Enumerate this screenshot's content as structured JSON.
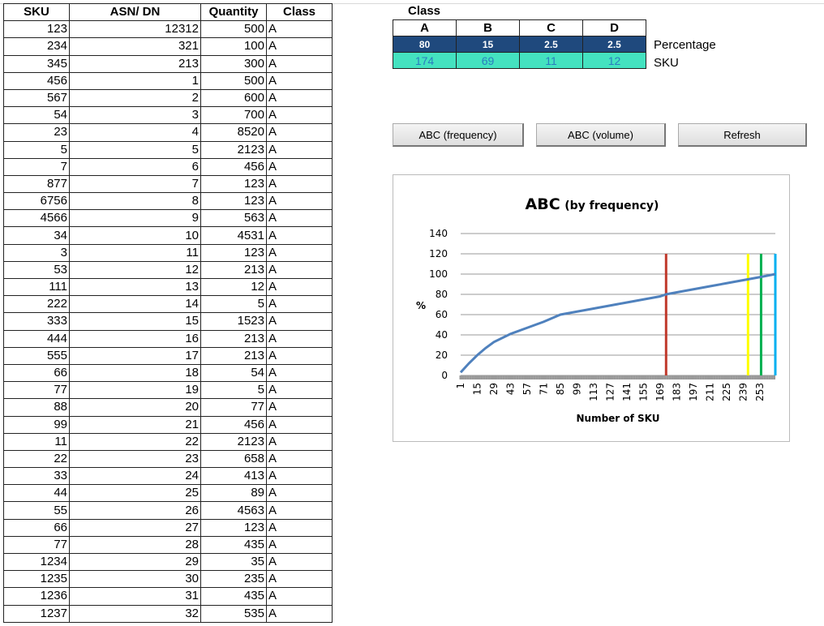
{
  "table": {
    "headers": [
      "SKU",
      "ASN/ DN",
      "Quantity",
      "Class"
    ],
    "rows": [
      [
        "123",
        "12312",
        "500",
        "A"
      ],
      [
        "234",
        "321",
        "100",
        "A"
      ],
      [
        "345",
        "213",
        "300",
        "A"
      ],
      [
        "456",
        "1",
        "500",
        "A"
      ],
      [
        "567",
        "2",
        "600",
        "A"
      ],
      [
        "54",
        "3",
        "700",
        "A"
      ],
      [
        "23",
        "4",
        "8520",
        "A"
      ],
      [
        "5",
        "5",
        "2123",
        "A"
      ],
      [
        "7",
        "6",
        "456",
        "A"
      ],
      [
        "877",
        "7",
        "123",
        "A"
      ],
      [
        "6756",
        "8",
        "123",
        "A"
      ],
      [
        "4566",
        "9",
        "563",
        "A"
      ],
      [
        "34",
        "10",
        "4531",
        "A"
      ],
      [
        "3",
        "11",
        "123",
        "A"
      ],
      [
        "53",
        "12",
        "213",
        "A"
      ],
      [
        "111",
        "13",
        "12",
        "A"
      ],
      [
        "222",
        "14",
        "5",
        "A"
      ],
      [
        "333",
        "15",
        "1523",
        "A"
      ],
      [
        "444",
        "16",
        "213",
        "A"
      ],
      [
        "555",
        "17",
        "213",
        "A"
      ],
      [
        "66",
        "18",
        "54",
        "A"
      ],
      [
        "77",
        "19",
        "5",
        "A"
      ],
      [
        "88",
        "20",
        "77",
        "A"
      ],
      [
        "99",
        "21",
        "456",
        "A"
      ],
      [
        "11",
        "22",
        "2123",
        "A"
      ],
      [
        "22",
        "23",
        "658",
        "A"
      ],
      [
        "33",
        "24",
        "413",
        "A"
      ],
      [
        "44",
        "25",
        "89",
        "A"
      ],
      [
        "55",
        "26",
        "4563",
        "A"
      ],
      [
        "66",
        "27",
        "123",
        "A"
      ],
      [
        "77",
        "28",
        "435",
        "A"
      ],
      [
        "1234",
        "29",
        "35",
        "A"
      ],
      [
        "1235",
        "30",
        "235",
        "A"
      ],
      [
        "1236",
        "31",
        "435",
        "A"
      ],
      [
        "1237",
        "32",
        "535",
        "A"
      ]
    ]
  },
  "class_table": {
    "title": "Class",
    "classes": [
      "A",
      "B",
      "C",
      "D"
    ],
    "percentage": [
      "80",
      "15",
      "2.5",
      "2.5"
    ],
    "sku": [
      "174",
      "69",
      "11",
      "12"
    ],
    "percentage_label": "Percentage",
    "sku_label": "SKU",
    "colors": {
      "percentage_bg": "#1f497d",
      "sku_bg": "#44e2c0"
    }
  },
  "buttons": {
    "frequency": "ABC (frequency)",
    "volume": "ABC (volume)",
    "refresh": "Refresh"
  },
  "chart_data": {
    "type": "line",
    "title": "ABC",
    "subtitle": "(by frequency)",
    "xlabel": "Number of SKU",
    "ylabel": "%",
    "ylim": [
      0,
      140
    ],
    "yticks": [
      0,
      20,
      40,
      60,
      80,
      100,
      120,
      140
    ],
    "xticks": [
      1,
      15,
      29,
      43,
      57,
      71,
      85,
      99,
      113,
      127,
      141,
      155,
      169,
      183,
      197,
      211,
      225,
      239,
      253
    ],
    "xlim": [
      1,
      266
    ],
    "grid": true,
    "series": [
      {
        "color": "#4f81bd",
        "x": [
          1,
          8,
          15,
          22,
          29,
          43,
          57,
          71,
          85,
          99,
          113,
          127,
          141,
          155,
          169,
          174,
          183,
          197,
          211,
          225,
          239,
          253,
          266
        ],
        "y": [
          3,
          12,
          20,
          27,
          33,
          41,
          47,
          53,
          60,
          63,
          66,
          69,
          72,
          75,
          78,
          80,
          82,
          85,
          88,
          91,
          94,
          97,
          100
        ]
      }
    ],
    "vertical_lines": [
      {
        "x": 174,
        "y": 120,
        "color": "#c0392b"
      },
      {
        "x": 243,
        "y": 120,
        "color": "#ffff00"
      },
      {
        "x": 254,
        "y": 120,
        "color": "#00b050"
      },
      {
        "x": 266,
        "y": 120,
        "color": "#00b0f0"
      }
    ]
  }
}
